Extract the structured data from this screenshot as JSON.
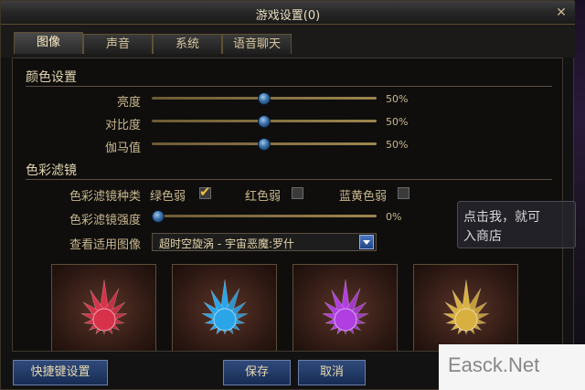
{
  "window": {
    "title": "游戏设置(0)",
    "close_glyph": "✕"
  },
  "tabs": [
    {
      "label": "图像",
      "active": true
    },
    {
      "label": "声音",
      "active": false
    },
    {
      "label": "系统",
      "active": false
    },
    {
      "label": "语音聊天",
      "active": false
    }
  ],
  "color_settings": {
    "title": "颜色设置",
    "rows": [
      {
        "label": "亮度",
        "value_text": "50%",
        "value": 0.5
      },
      {
        "label": "对比度",
        "value_text": "50%",
        "value": 0.5
      },
      {
        "label": "伽马值",
        "value_text": "50%",
        "value": 0.5
      }
    ]
  },
  "color_filter": {
    "title": "色彩滤镜",
    "type_label": "色彩滤镜种类",
    "options": [
      {
        "label": "绿色弱",
        "checked": true
      },
      {
        "label": "红色弱",
        "checked": false
      },
      {
        "label": "蓝黄色弱",
        "checked": false
      }
    ],
    "strength_label": "色彩滤镜强度",
    "strength_value_text": "0%",
    "strength_value": 0,
    "preview_label": "查看适用图像",
    "preview_selected": "超时空旋涡 - 宇宙恶魔:罗什",
    "thumbnails": [
      {
        "name": "red-crystal",
        "color": "#d8324a"
      },
      {
        "name": "blue-crystal",
        "color": "#2aa6e8"
      },
      {
        "name": "purple-crystal",
        "color": "#b03ee0"
      },
      {
        "name": "gold-crystal",
        "color": "#d8b040"
      }
    ]
  },
  "buttons": {
    "hotkey": "快捷键设置",
    "save": "保存",
    "cancel": "取消"
  },
  "tooltip": {
    "line1": "点击我，就可",
    "line2": "入商店"
  },
  "watermark": "Easck.Net"
}
